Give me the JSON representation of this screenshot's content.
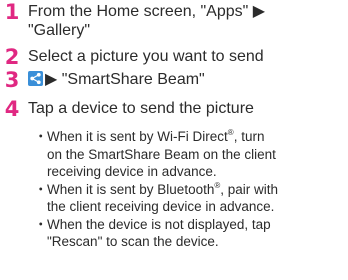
{
  "steps": [
    {
      "number": "1",
      "line1": "From the Home screen, \"Apps\" ▶",
      "line2": "\"Gallery\""
    },
    {
      "number": "2",
      "text": "Select a picture you want to send"
    },
    {
      "number": "3",
      "icon": "share-icon",
      "text": "▶ \"SmartShare Beam\""
    },
    {
      "number": "4",
      "text": "Tap a device to send the picture"
    }
  ],
  "bullets": [
    {
      "a": "When it is sent by Wi-Fi Direct",
      "sup": "®",
      "b": ", turn",
      "line2": "on the SmartShare Beam on the client",
      "line3": "receiving device in advance."
    },
    {
      "a": "When it is sent by Bluetooth",
      "sup": "®",
      "b": ", pair with",
      "line2": "the client receiving device in advance."
    },
    {
      "a": "When the device is not displayed, tap",
      "line2": "\"Rescan\" to scan the device."
    }
  ],
  "bullet_symbol": "・",
  "colors": {
    "step_number": "#e02882",
    "text": "#2b2b2b",
    "share_icon_bg": "#3a8fd8"
  }
}
